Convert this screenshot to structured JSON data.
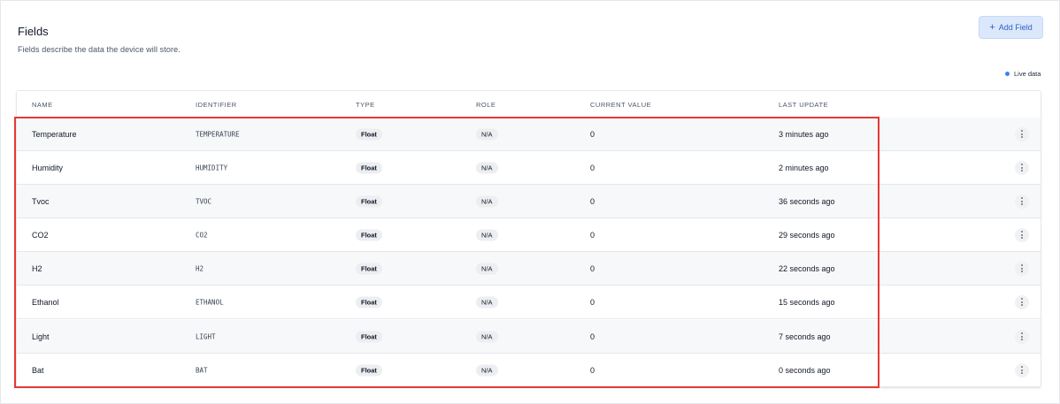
{
  "header": {
    "title": "Fields",
    "subtitle": "Fields describe the data the device will store.",
    "add_button_label": "Add Field",
    "live_label": "Live data"
  },
  "table": {
    "columns": [
      "NAME",
      "IDENTIFIER",
      "TYPE",
      "ROLE",
      "CURRENT VALUE",
      "LAST UPDATE"
    ],
    "rows": [
      {
        "name": "Temperature",
        "identifier": "TEMPERATURE",
        "type": "Float",
        "role": "N/A",
        "value": "0",
        "updated": "3 minutes ago"
      },
      {
        "name": "Humidity",
        "identifier": "HUMIDITY",
        "type": "Float",
        "role": "N/A",
        "value": "0",
        "updated": "2 minutes ago"
      },
      {
        "name": "Tvoc",
        "identifier": "TVOC",
        "type": "Float",
        "role": "N/A",
        "value": "0",
        "updated": "36 seconds ago"
      },
      {
        "name": "CO2",
        "identifier": "CO2",
        "type": "Float",
        "role": "N/A",
        "value": "0",
        "updated": "29 seconds ago"
      },
      {
        "name": "H2",
        "identifier": "H2",
        "type": "Float",
        "role": "N/A",
        "value": "0",
        "updated": "22 seconds ago"
      },
      {
        "name": "Ethanol",
        "identifier": "ETHANOL",
        "type": "Float",
        "role": "N/A",
        "value": "0",
        "updated": "15 seconds ago"
      },
      {
        "name": "Light",
        "identifier": "LIGHT",
        "type": "Float",
        "role": "N/A",
        "value": "0",
        "updated": "7 seconds ago"
      },
      {
        "name": "Bat",
        "identifier": "BAT",
        "type": "Float",
        "role": "N/A",
        "value": "0",
        "updated": "0 seconds ago"
      }
    ]
  },
  "icons": {
    "add": "plus-icon",
    "live": "live-dot-icon",
    "row_menu": "more-vertical-icon"
  },
  "colors": {
    "accent": "#3b82f6",
    "button_bg": "#dbe7fb",
    "highlight": "#e53935"
  }
}
